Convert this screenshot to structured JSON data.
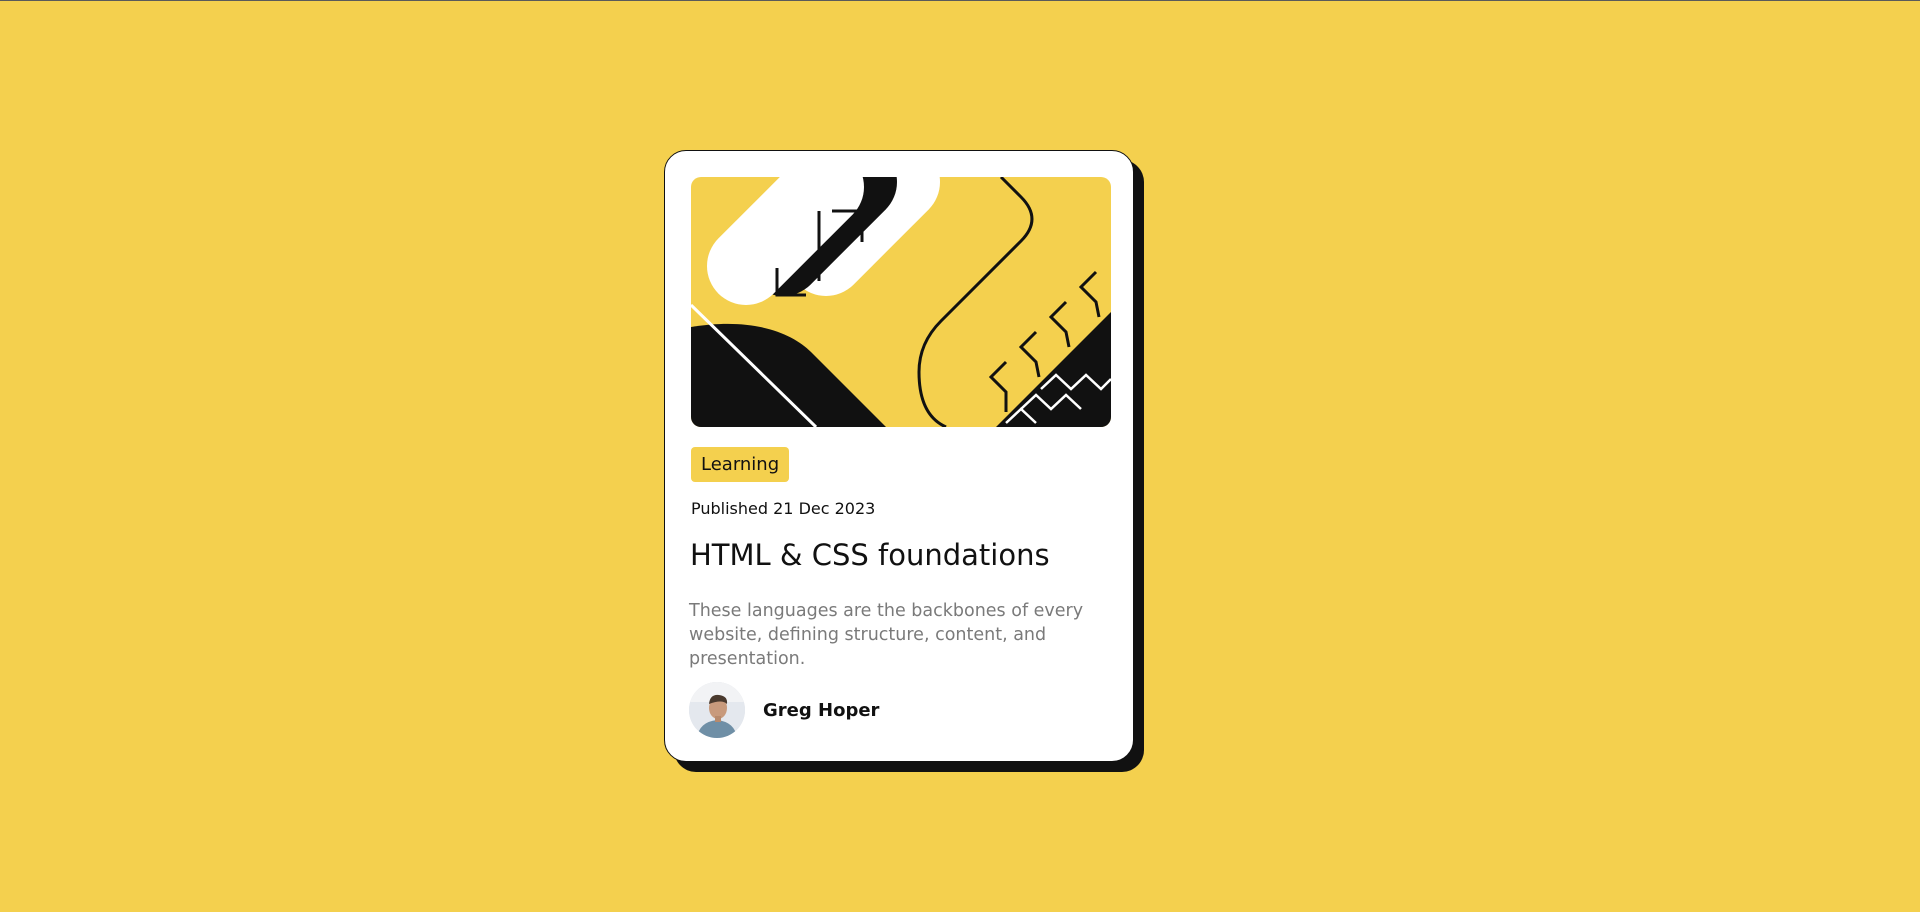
{
  "card": {
    "tag": "Learning",
    "published": "Published 21 Dec 2023",
    "title": "HTML & CSS foundations",
    "description": "These languages are the backbones of every website, defining structure, content, and presentation.",
    "author": {
      "name": "Greg Hoper"
    }
  },
  "colors": {
    "background": "#F4D04E",
    "card": "#FFFFFF",
    "ink": "#111111",
    "muted": "#7A7A7A",
    "accent": "#F4D04E"
  },
  "icons": {
    "hero": "abstract-illustration",
    "avatar": "author-photo"
  }
}
